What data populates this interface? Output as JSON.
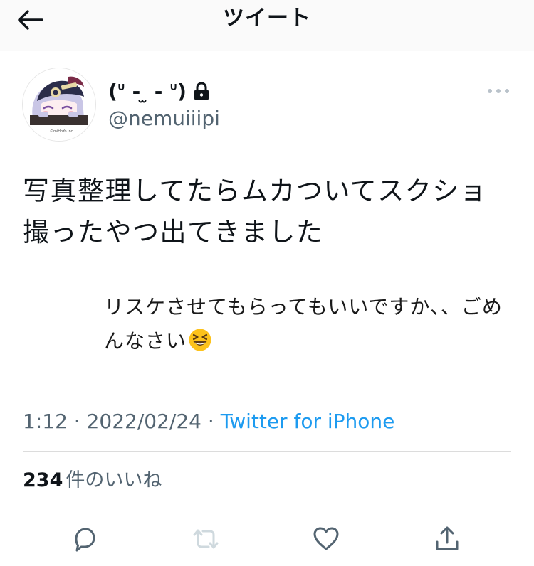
{
  "header": {
    "title": "ツイート",
    "back_icon": "back-arrow-icon"
  },
  "tweet": {
    "author": {
      "display_name": "(ᐡ - ̫ - ᐡ)",
      "handle": "@nemuiiipi",
      "protected_icon": "lock-icon",
      "avatar_caption": "©miHoYo.Inc"
    },
    "text": "写真整理してたらムカついてスクショ撮ったやつ出てきました",
    "screenshot_text": "リスケさせてもらってもいいですか、、ごめんなさい",
    "screenshot_emoji": "grinning-squinting-face",
    "time": "1:12",
    "separator": "·",
    "date": "2022/02/24",
    "source": "Twitter for iPhone",
    "likes_count": "234",
    "likes_label": "件のいいね"
  },
  "actions": [
    {
      "icon": "reply-icon",
      "enabled": true
    },
    {
      "icon": "retweet-icon",
      "enabled": false
    },
    {
      "icon": "like-icon",
      "enabled": true
    },
    {
      "icon": "share-icon",
      "enabled": true
    }
  ],
  "colors": {
    "text": "#0f1419",
    "secondary": "#536471",
    "link": "#1d9bf0",
    "icon": "#536471",
    "disabled_icon": "#cfd9de",
    "divider": "#dcdcdc",
    "header_bg": "#fafafa"
  }
}
